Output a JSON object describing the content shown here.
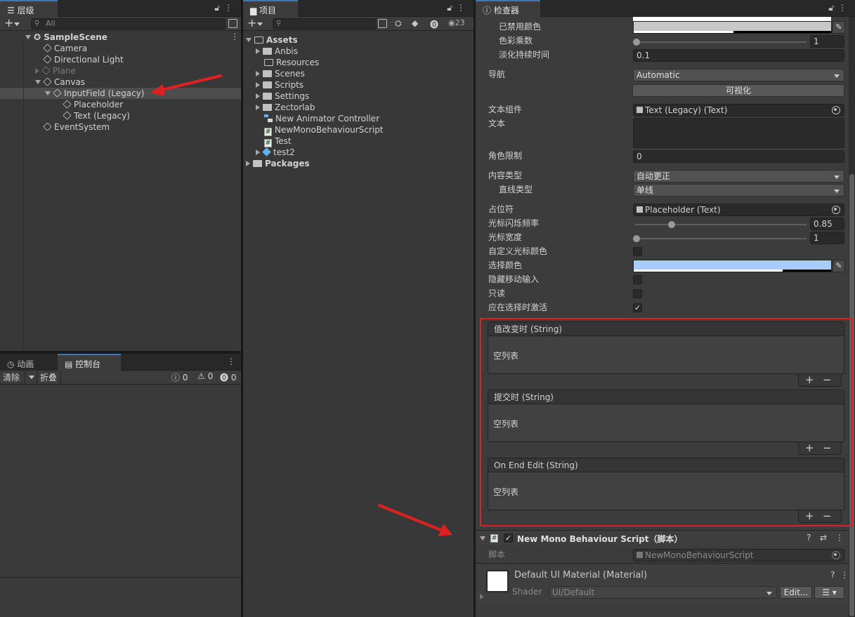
{
  "hierarchy": {
    "tab_label": "层级",
    "search_placeholder": "All",
    "scene_name": "SampleScene",
    "items": [
      {
        "label": "Camera"
      },
      {
        "label": "Directional Light"
      },
      {
        "label": "Plane"
      },
      {
        "label": "Canvas"
      },
      {
        "label": "InputField (Legacy)"
      },
      {
        "label": "Placeholder"
      },
      {
        "label": "Text (Legacy)"
      },
      {
        "label": "EventSystem"
      }
    ]
  },
  "console": {
    "tabs": [
      "动画",
      "控制台"
    ],
    "clear_label": "清除",
    "collapse_label": "折叠",
    "counts": [
      "0",
      "0",
      "0"
    ]
  },
  "project": {
    "tab_label": "项目",
    "hidden_count": "23",
    "assets_label": "Assets",
    "items": [
      {
        "label": "Anbis"
      },
      {
        "label": "Resources"
      },
      {
        "label": "Scenes"
      },
      {
        "label": "Scripts"
      },
      {
        "label": "Settings"
      },
      {
        "label": "Zectorlab"
      },
      {
        "label": "New Animator Controller"
      },
      {
        "label": "NewMonoBehaviourScript"
      },
      {
        "label": "Test"
      },
      {
        "label": "test2"
      }
    ],
    "packages_label": "Packages"
  },
  "inspector": {
    "tab_label": "检查器",
    "disabled_color_label": "已禁用颜色",
    "color_multiplier_label": "色彩乘数",
    "color_multiplier_value": "1",
    "fade_duration_label": "淡化持续时间",
    "fade_duration_value": "0.1",
    "navigation_label": "导航",
    "navigation_value": "Automatic",
    "visualize_label": "可视化",
    "text_component_label": "文本组件",
    "text_component_value": "Text (Legacy) (Text)",
    "text_label": "文本",
    "char_limit_label": "角色限制",
    "char_limit_value": "0",
    "content_type_label": "内容类型",
    "content_type_value": "自动更正",
    "line_type_label": "直线类型",
    "line_type_value": "单线",
    "placeholder_label": "占位符",
    "placeholder_value": "Placeholder (Text)",
    "caret_blink_label": "光标闪烁频率",
    "caret_blink_value": "0.85",
    "caret_width_label": "光标宽度",
    "caret_width_value": "1",
    "custom_caret_label": "自定义光标颜色",
    "selection_color_label": "选择颜色",
    "hide_mobile_label": "隐藏移动输入",
    "readonly_label": "只读",
    "activate_on_select_label": "应在选择时激活",
    "events": [
      {
        "title": "值改变时 (String)",
        "empty": "空列表"
      },
      {
        "title": "提交时 (String)",
        "empty": "空列表"
      },
      {
        "title": "On End Edit (String)",
        "empty": "空列表"
      }
    ],
    "script_component_title": "New Mono Behaviour Script（脚本）",
    "script_label": "脚本",
    "script_value": "NewMonoBehaviourScript",
    "material_title": "Default UI Material (Material)",
    "shader_label": "Shader",
    "shader_value": "UI/Default",
    "edit_label": "Edit..."
  },
  "colors": {
    "accent_tab": "#3a79bb",
    "annotation_red": "#e02020",
    "selection_color": "#a8cdfb"
  }
}
